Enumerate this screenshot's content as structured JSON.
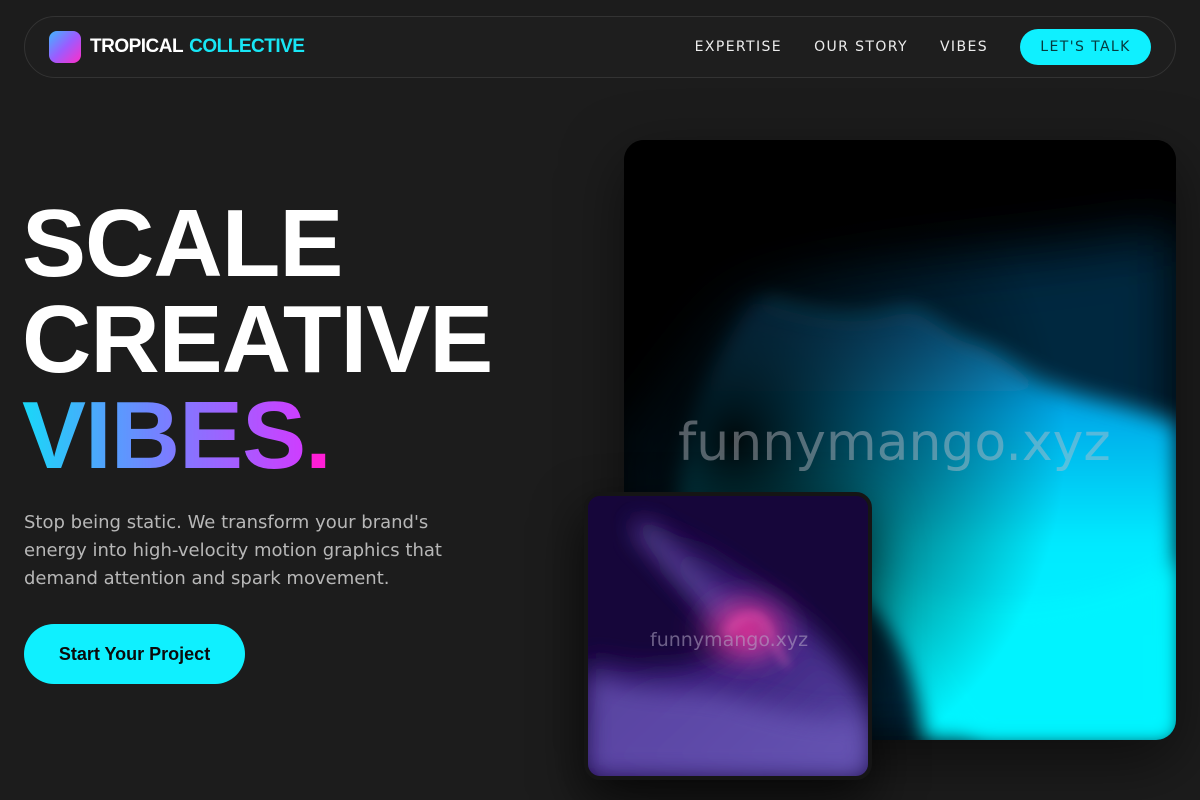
{
  "brand": {
    "name_part1": "TROPICAL",
    "name_part2": "COLLECTIVE"
  },
  "nav": {
    "links": [
      "EXPERTISE",
      "OUR STORY",
      "VIBES"
    ],
    "cta_label": "LET'S TALK"
  },
  "hero": {
    "line1": "SCALE",
    "line2": "CREATIVE",
    "line3": "VIBES",
    "line3_dot": ".",
    "subtext": "Stop being static. We transform your brand's energy into high-velocity motion graphics that demand attention and spark movement.",
    "cta_label": "Start Your Project"
  },
  "visuals": {
    "watermark_big": "funnymango.xyz",
    "watermark_small": "funnymango.xyz"
  },
  "colors": {
    "accent": "#0ff0ff",
    "background": "#1c1c1c",
    "magenta": "#ff1ed6"
  }
}
